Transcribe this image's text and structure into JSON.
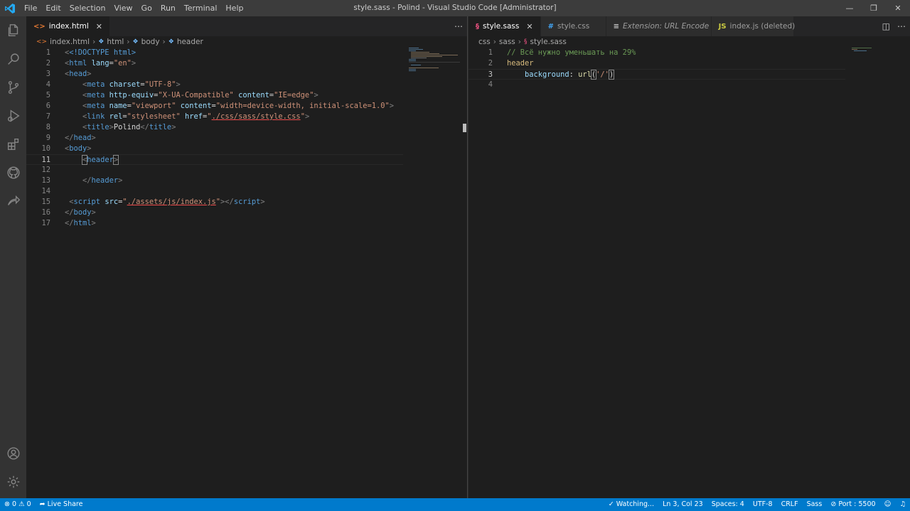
{
  "window": {
    "title": "style.sass - Polind - Visual Studio Code [Administrator]",
    "menu": [
      "File",
      "Edit",
      "Selection",
      "View",
      "Go",
      "Run",
      "Terminal",
      "Help"
    ]
  },
  "activity_bar": [
    "explorer-icon",
    "search-icon",
    "source-control-icon",
    "run-debug-icon",
    "extensions-icon",
    "github-icon",
    "live-share-icon",
    "account-icon",
    "settings-gear-icon"
  ],
  "left_editor": {
    "tabs": [
      {
        "label": "index.html",
        "icon": "<>",
        "active": true
      }
    ],
    "breadcrumb": [
      "index.html",
      "html",
      "body",
      "header"
    ],
    "line_numbers": [
      "1",
      "2",
      "3",
      "4",
      "5",
      "6",
      "7",
      "8",
      "9",
      "10",
      "11",
      "12",
      "13",
      "14",
      "15",
      "16",
      "17"
    ],
    "current_line": "11"
  },
  "right_editor": {
    "tabs": [
      {
        "label": "style.sass",
        "icon": "§"
      },
      {
        "label": "style.css",
        "icon": "#"
      },
      {
        "label": "Extension: URL Encode",
        "icon": "≡"
      },
      {
        "label": "index.js (deleted)",
        "icon": "JS"
      }
    ],
    "breadcrumb": [
      "css",
      "sass",
      "style.sass"
    ],
    "line_numbers": [
      "1",
      "2",
      "3",
      "4"
    ],
    "current_line": "3"
  },
  "code_left": {
    "doctype": "<!DOCTYPE html>",
    "html_lang": "en",
    "charset": "UTF-8",
    "equiv_name": "X-UA-Compatible",
    "equiv_content": "IE=edge",
    "viewport_name": "viewport",
    "viewport_content": "width=device-width, initial-scale=1.0",
    "link_rel": "stylesheet",
    "link_href": "./css/sass/style.css",
    "title_text": "Polind",
    "script_src": "./assets/js/index.js"
  },
  "code_right": {
    "comment": "// Всё нужно уменьшать на 29%",
    "selector": "header",
    "property": "background",
    "value_fn": "url",
    "value_arg": "'/'"
  },
  "status_bar": {
    "errors": "0",
    "warnings": "0",
    "live_share": "Live Share",
    "watching": "Watching...",
    "position": "Ln 3, Col 23",
    "spaces": "Spaces: 4",
    "encoding": "UTF-8",
    "eol": "CRLF",
    "language": "Sass",
    "port": "Port : 5500"
  },
  "colors": {
    "accent": "#007acc",
    "titlebar": "#3c3c3c",
    "activitybar": "#333333",
    "editor": "#1e1e1e"
  }
}
